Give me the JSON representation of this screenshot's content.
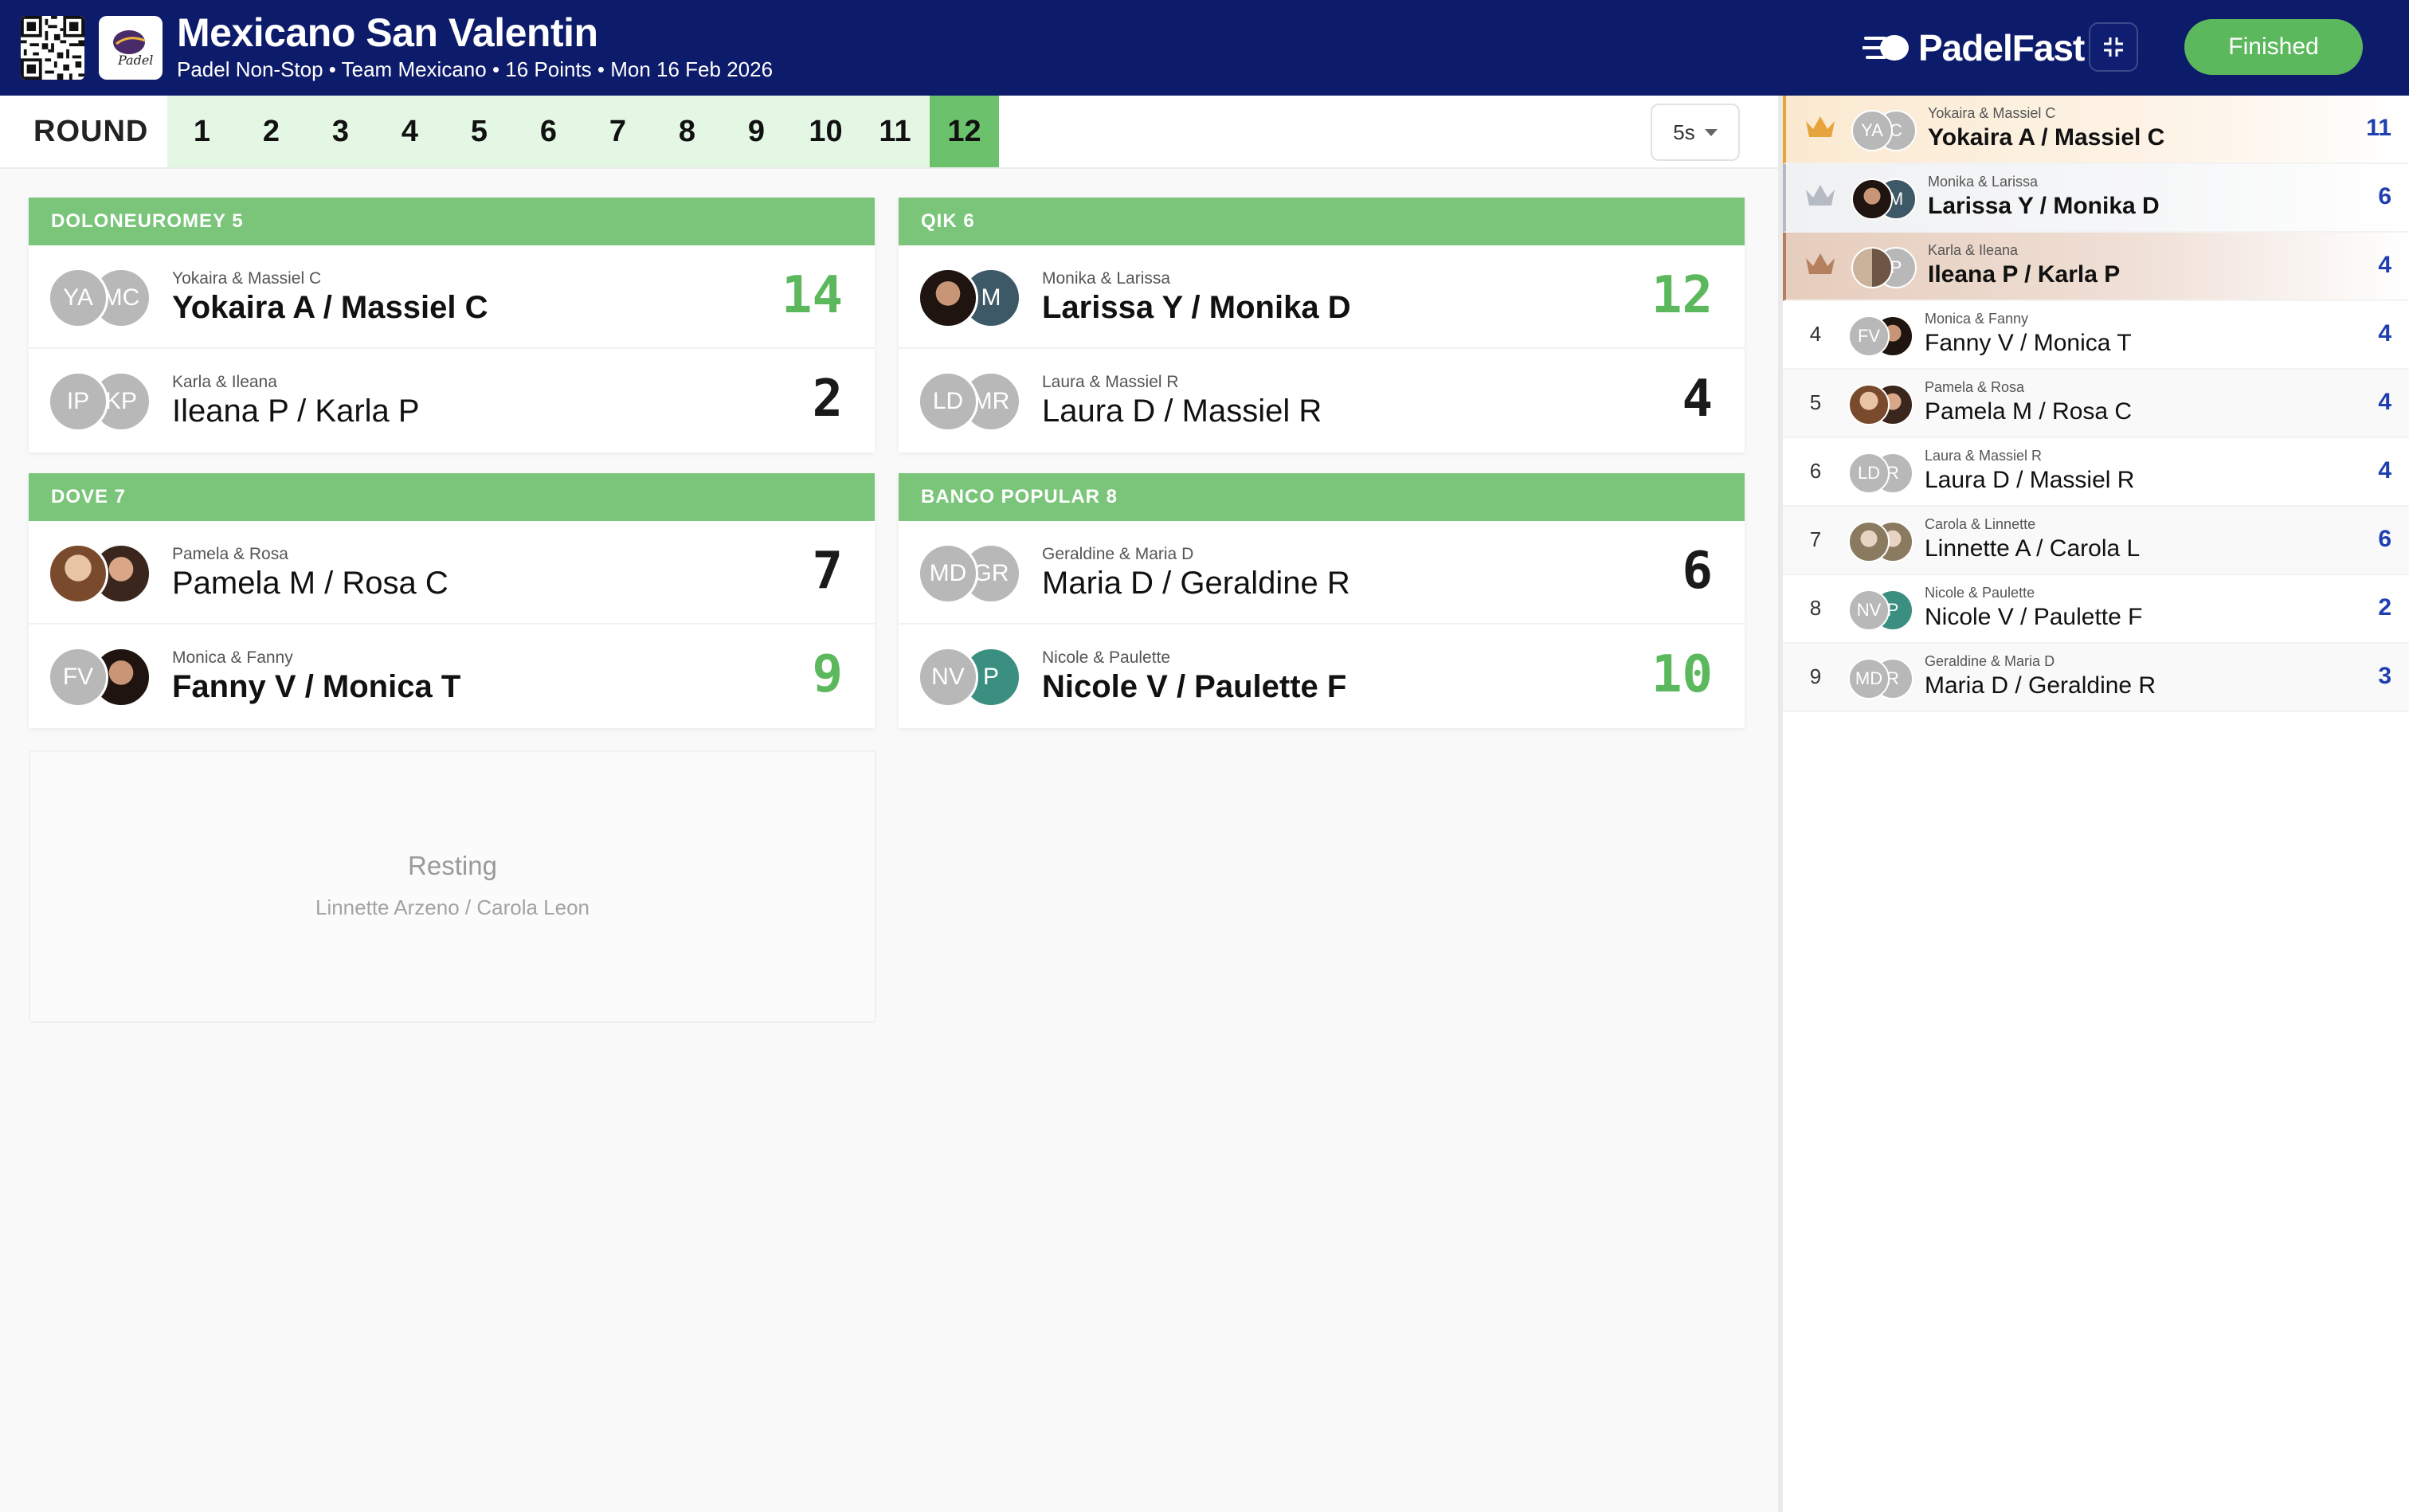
{
  "header": {
    "title": "Mexicano San Valentin",
    "subtitle": "Padel Non-Stop • Team Mexicano • 16 Points • Mon 16 Feb 2026",
    "brand": "PadelFast",
    "logo_text": "Padel",
    "finished_label": "Finished"
  },
  "rounds": {
    "label": "ROUND",
    "items": [
      "1",
      "2",
      "3",
      "4",
      "5",
      "6",
      "7",
      "8",
      "9",
      "10",
      "11",
      "12"
    ],
    "active": "12",
    "timer_value": "5s"
  },
  "matches": [
    {
      "court": "DOLONEUROMEY 5",
      "teams": [
        {
          "pair": "Yokaira & Massiel C",
          "name": "Yokaira A / Massiel C",
          "initials": [
            "YA",
            "MC"
          ],
          "score": "14",
          "winner": true
        },
        {
          "pair": "Karla & Ileana",
          "name": "Ileana P / Karla P",
          "initials": [
            "IP",
            "KP"
          ],
          "score": "2",
          "winner": false
        }
      ]
    },
    {
      "court": "QIK 6",
      "teams": [
        {
          "pair": "Monika & Larissa",
          "name": "Larissa Y / Monika D",
          "initials": [
            "",
            "M"
          ],
          "score": "12",
          "winner": true
        },
        {
          "pair": "Laura & Massiel R",
          "name": "Laura D / Massiel R",
          "initials": [
            "LD",
            "MR"
          ],
          "score": "4",
          "winner": false
        }
      ]
    },
    {
      "court": "DOVE 7",
      "teams": [
        {
          "pair": "Pamela & Rosa",
          "name": "Pamela M / Rosa C",
          "initials": [
            "",
            ""
          ],
          "score": "7",
          "winner": false
        },
        {
          "pair": "Monica & Fanny",
          "name": "Fanny V / Monica T",
          "initials": [
            "FV",
            ""
          ],
          "score": "9",
          "winner": true
        }
      ]
    },
    {
      "court": "BANCO POPULAR 8",
      "teams": [
        {
          "pair": "Geraldine & Maria D",
          "name": "Maria D / Geraldine R",
          "initials": [
            "MD",
            "GR"
          ],
          "score": "6",
          "winner": false
        },
        {
          "pair": "Nicole & Paulette",
          "name": "Nicole V / Paulette F",
          "initials": [
            "NV",
            "P"
          ],
          "score": "10",
          "winner": true
        }
      ]
    }
  ],
  "resting": {
    "title": "Resting",
    "names": "Linnette Arzeno / Carola Leon"
  },
  "standings": [
    {
      "rank": "",
      "pair": "Yokaira & Massiel C",
      "name": "Yokaira A / Massiel C",
      "initials": [
        "YA",
        "C"
      ],
      "points": "11",
      "medal": "gold"
    },
    {
      "rank": "",
      "pair": "Monika & Larissa",
      "name": "Larissa Y / Monika D",
      "initials": [
        "",
        "M"
      ],
      "points": "6",
      "medal": "silver"
    },
    {
      "rank": "",
      "pair": "Karla & Ileana",
      "name": "Ileana P / Karla P",
      "initials": [
        "",
        "P"
      ],
      "points": "4",
      "medal": "bronze"
    },
    {
      "rank": "4",
      "pair": "Monica & Fanny",
      "name": "Fanny V / Monica T",
      "initials": [
        "FV",
        ""
      ],
      "points": "4",
      "medal": ""
    },
    {
      "rank": "5",
      "pair": "Pamela & Rosa",
      "name": "Pamela M / Rosa C",
      "initials": [
        "",
        ""
      ],
      "points": "4",
      "medal": ""
    },
    {
      "rank": "6",
      "pair": "Laura & Massiel R",
      "name": "Laura D / Massiel R",
      "initials": [
        "LD",
        "R"
      ],
      "points": "4",
      "medal": ""
    },
    {
      "rank": "7",
      "pair": "Carola & Linnette",
      "name": "Linnette A / Carola L",
      "initials": [
        "",
        ""
      ],
      "points": "6",
      "medal": ""
    },
    {
      "rank": "8",
      "pair": "Nicole & Paulette",
      "name": "Nicole V / Paulette F",
      "initials": [
        "NV",
        "P"
      ],
      "points": "2",
      "medal": ""
    },
    {
      "rank": "9",
      "pair": "Geraldine & Maria D",
      "name": "Maria D / Geraldine R",
      "initials": [
        "MD",
        "R"
      ],
      "points": "3",
      "medal": ""
    }
  ]
}
